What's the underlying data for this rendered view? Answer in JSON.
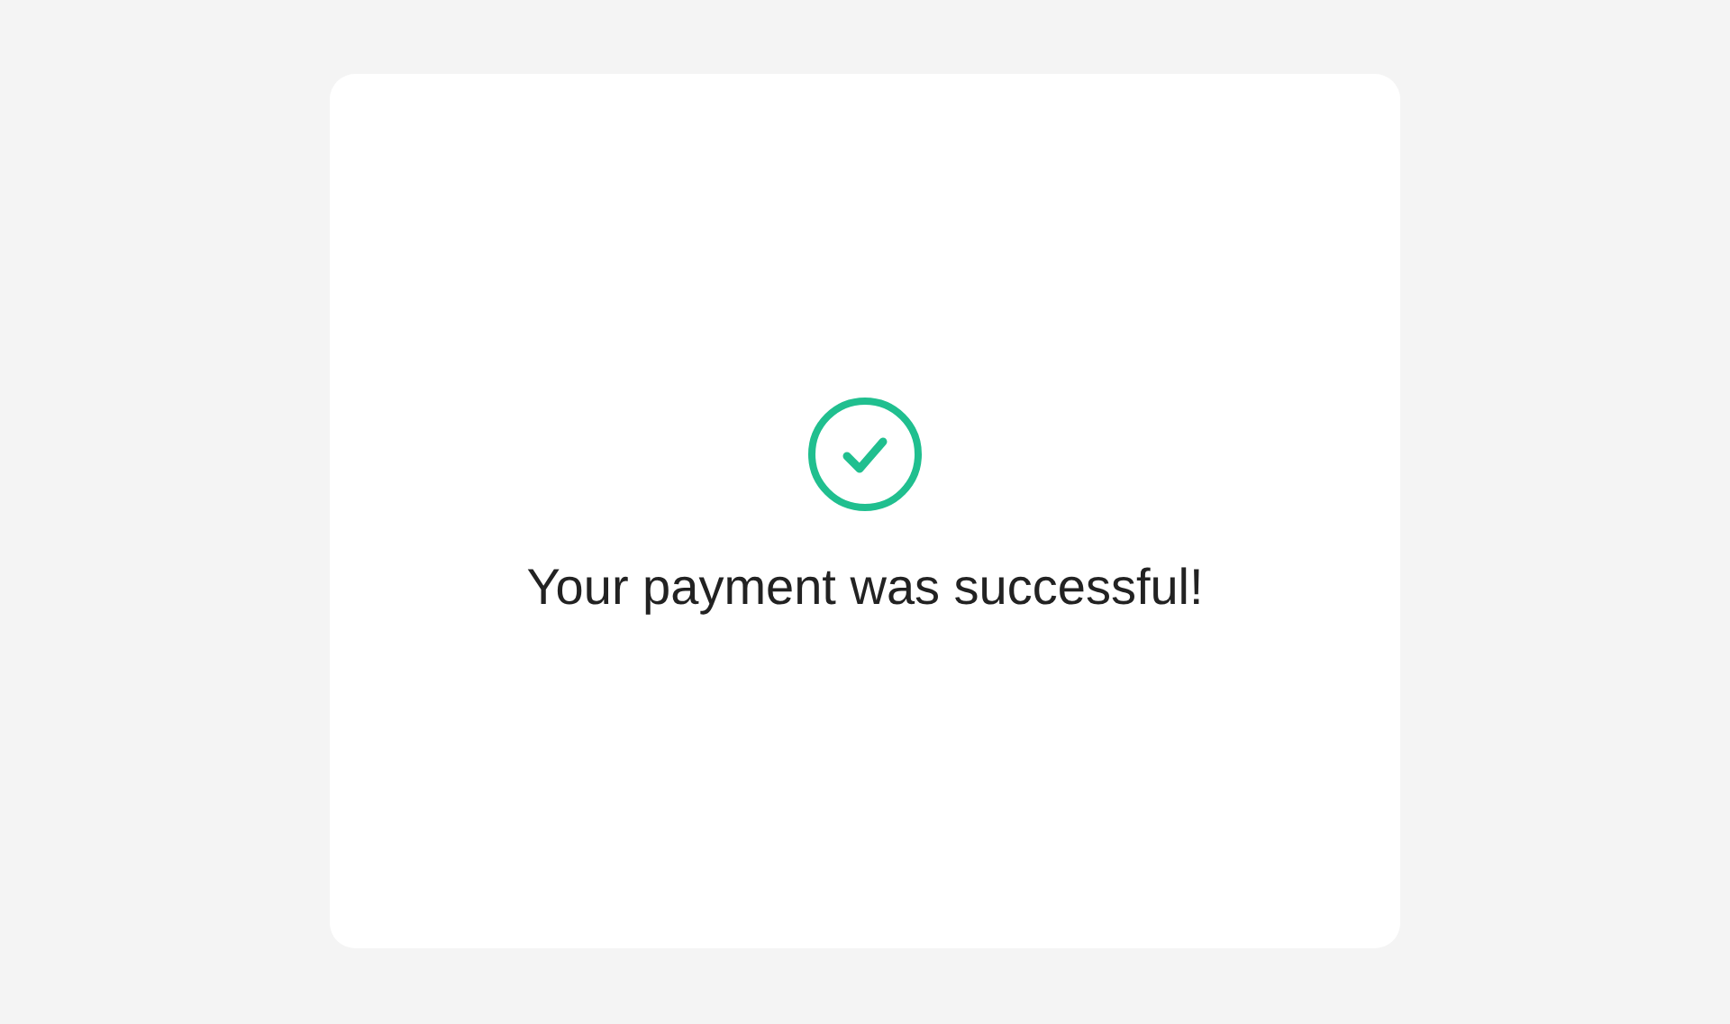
{
  "status": {
    "kind": "success",
    "message": "Your payment was successful!"
  }
}
